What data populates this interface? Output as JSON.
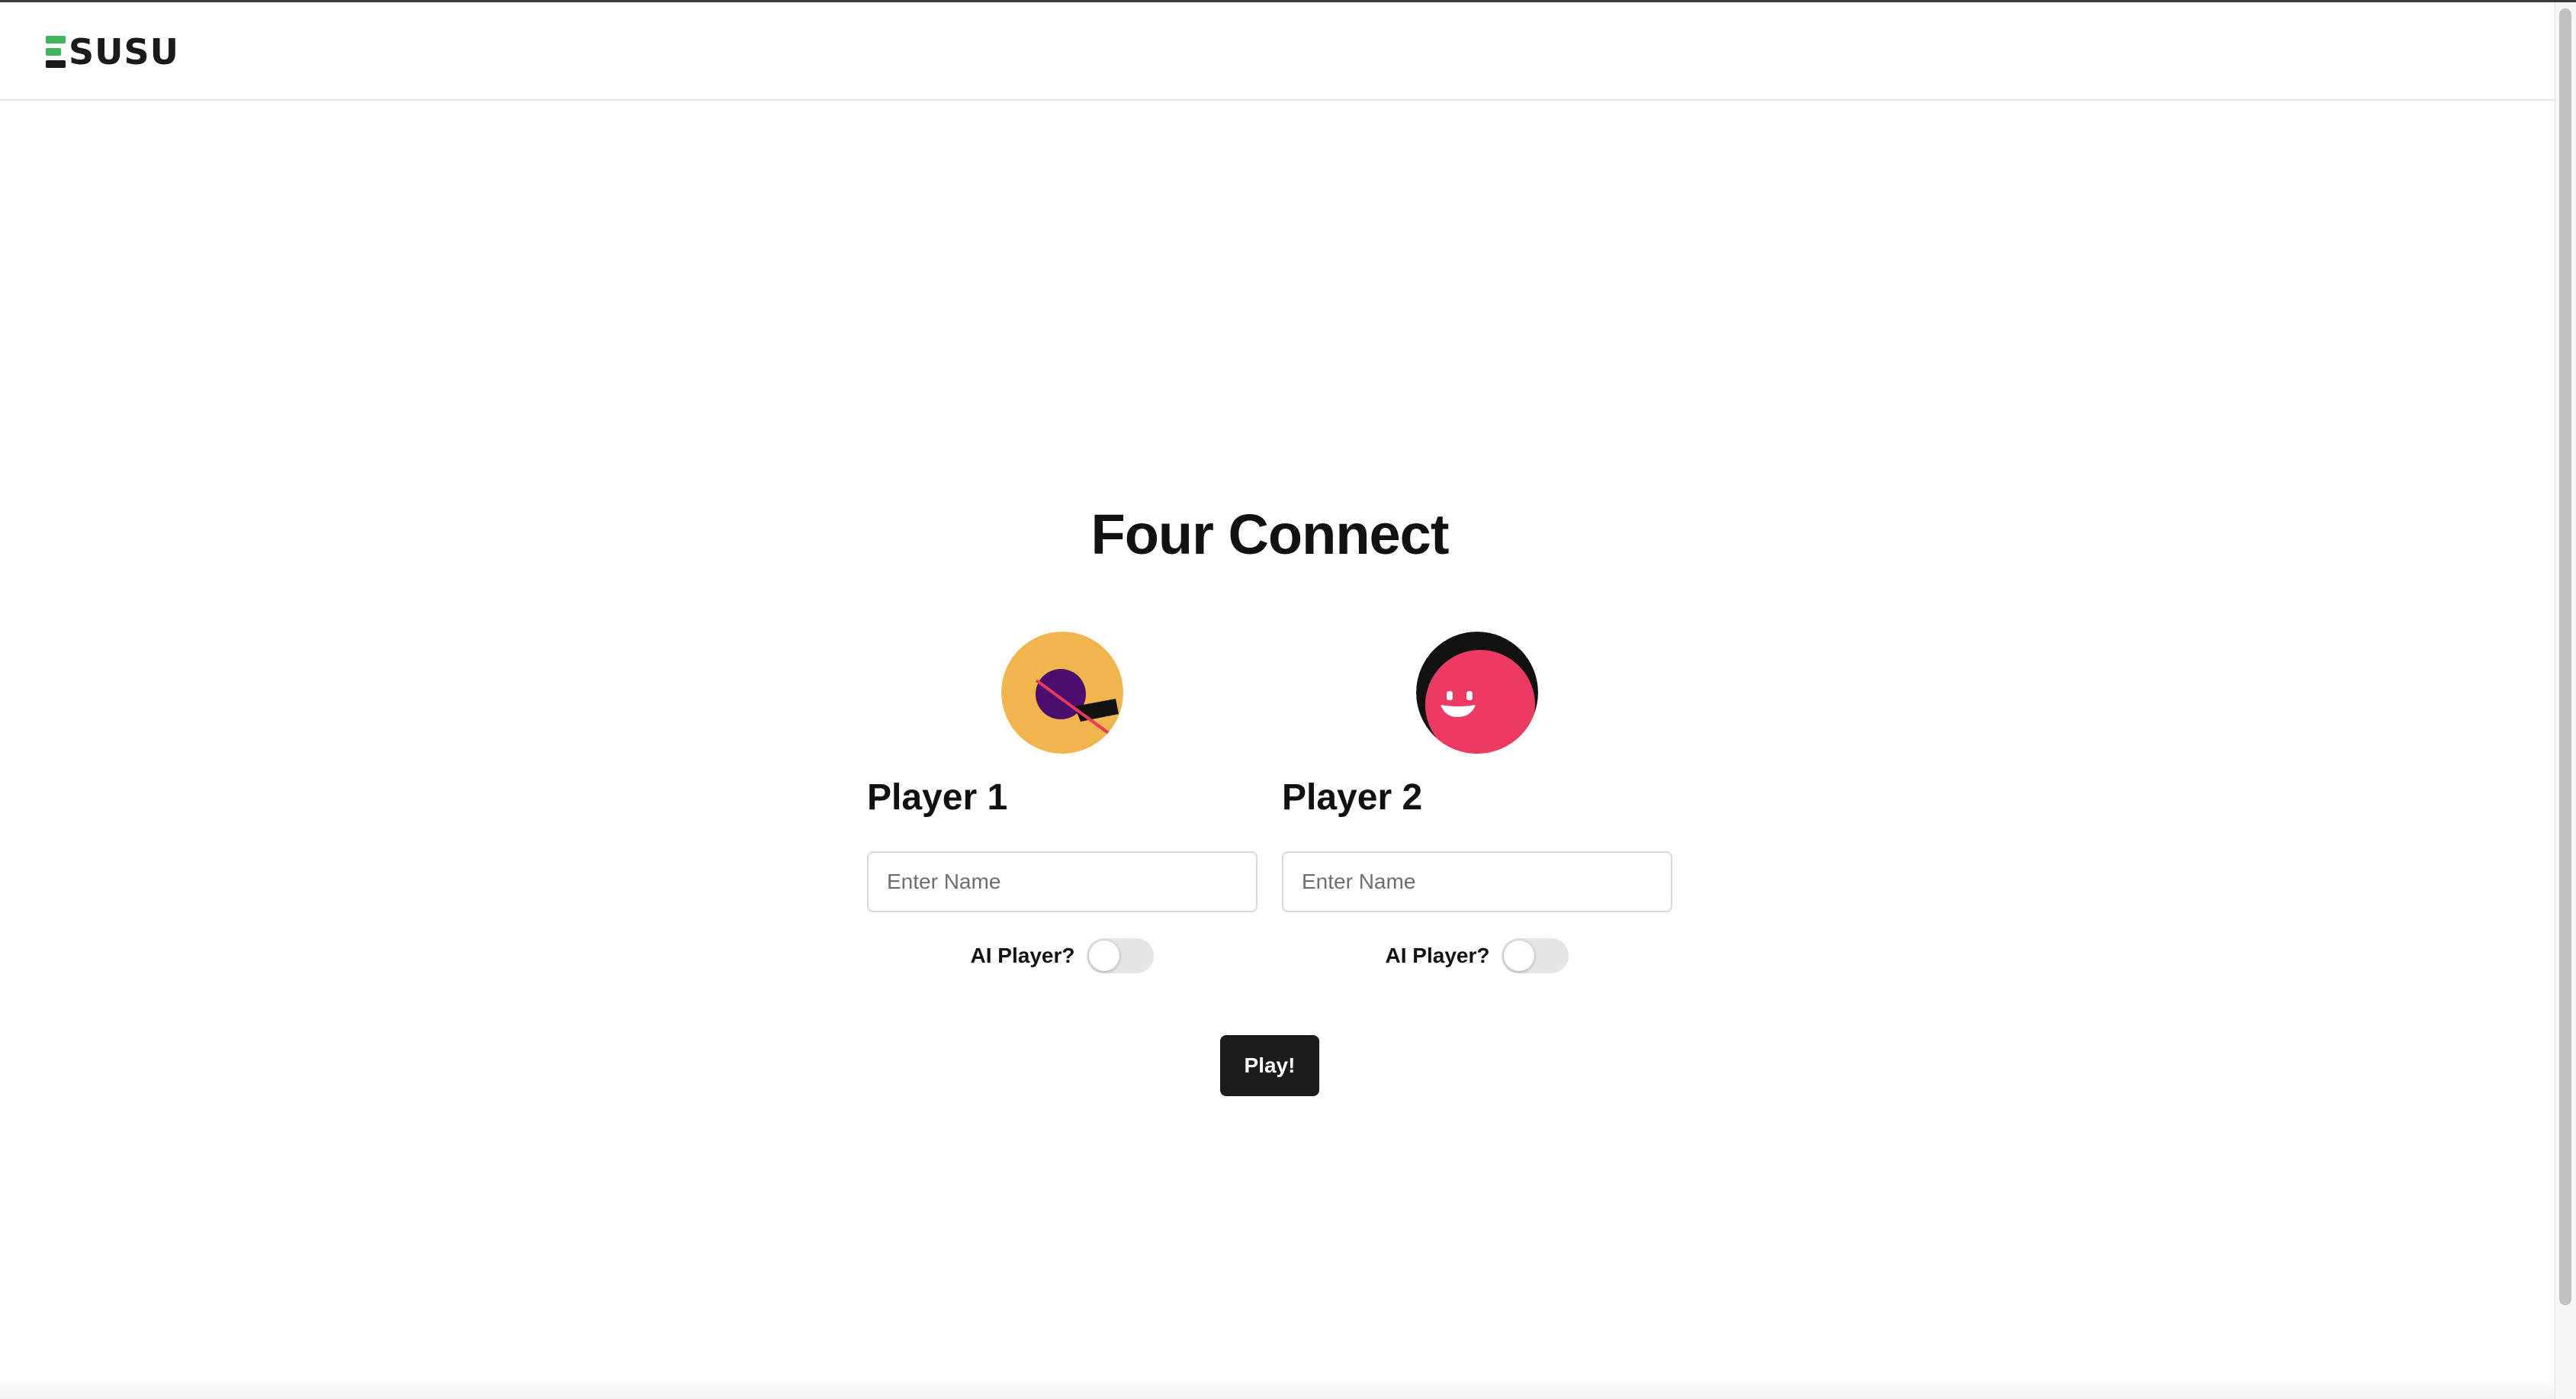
{
  "header": {
    "logo_text": "SUSU",
    "logo_colors": {
      "accent": "#3fb65d",
      "dark": "#1a1a1a"
    }
  },
  "main": {
    "title": "Four Connect",
    "players": [
      {
        "label": "Player 1",
        "avatar_icon": "player-one-avatar-icon",
        "avatar_colors": {
          "background": "#f2b44c",
          "eye": "#4a0e6e",
          "accent": "#111111",
          "stroke": "#e43b5b"
        },
        "name_placeholder": "Enter Name",
        "name_value": "",
        "ai_label": "AI Player?",
        "ai_enabled": false
      },
      {
        "label": "Player 2",
        "avatar_icon": "player-two-avatar-icon",
        "avatar_colors": {
          "background": "#ec3a62",
          "hair": "#111111",
          "face": "#ffffff"
        },
        "name_placeholder": "Enter Name",
        "name_value": "",
        "ai_label": "AI Player?",
        "ai_enabled": false
      }
    ],
    "play_label": "Play!",
    "play_button_color": "#1b1b1b"
  }
}
